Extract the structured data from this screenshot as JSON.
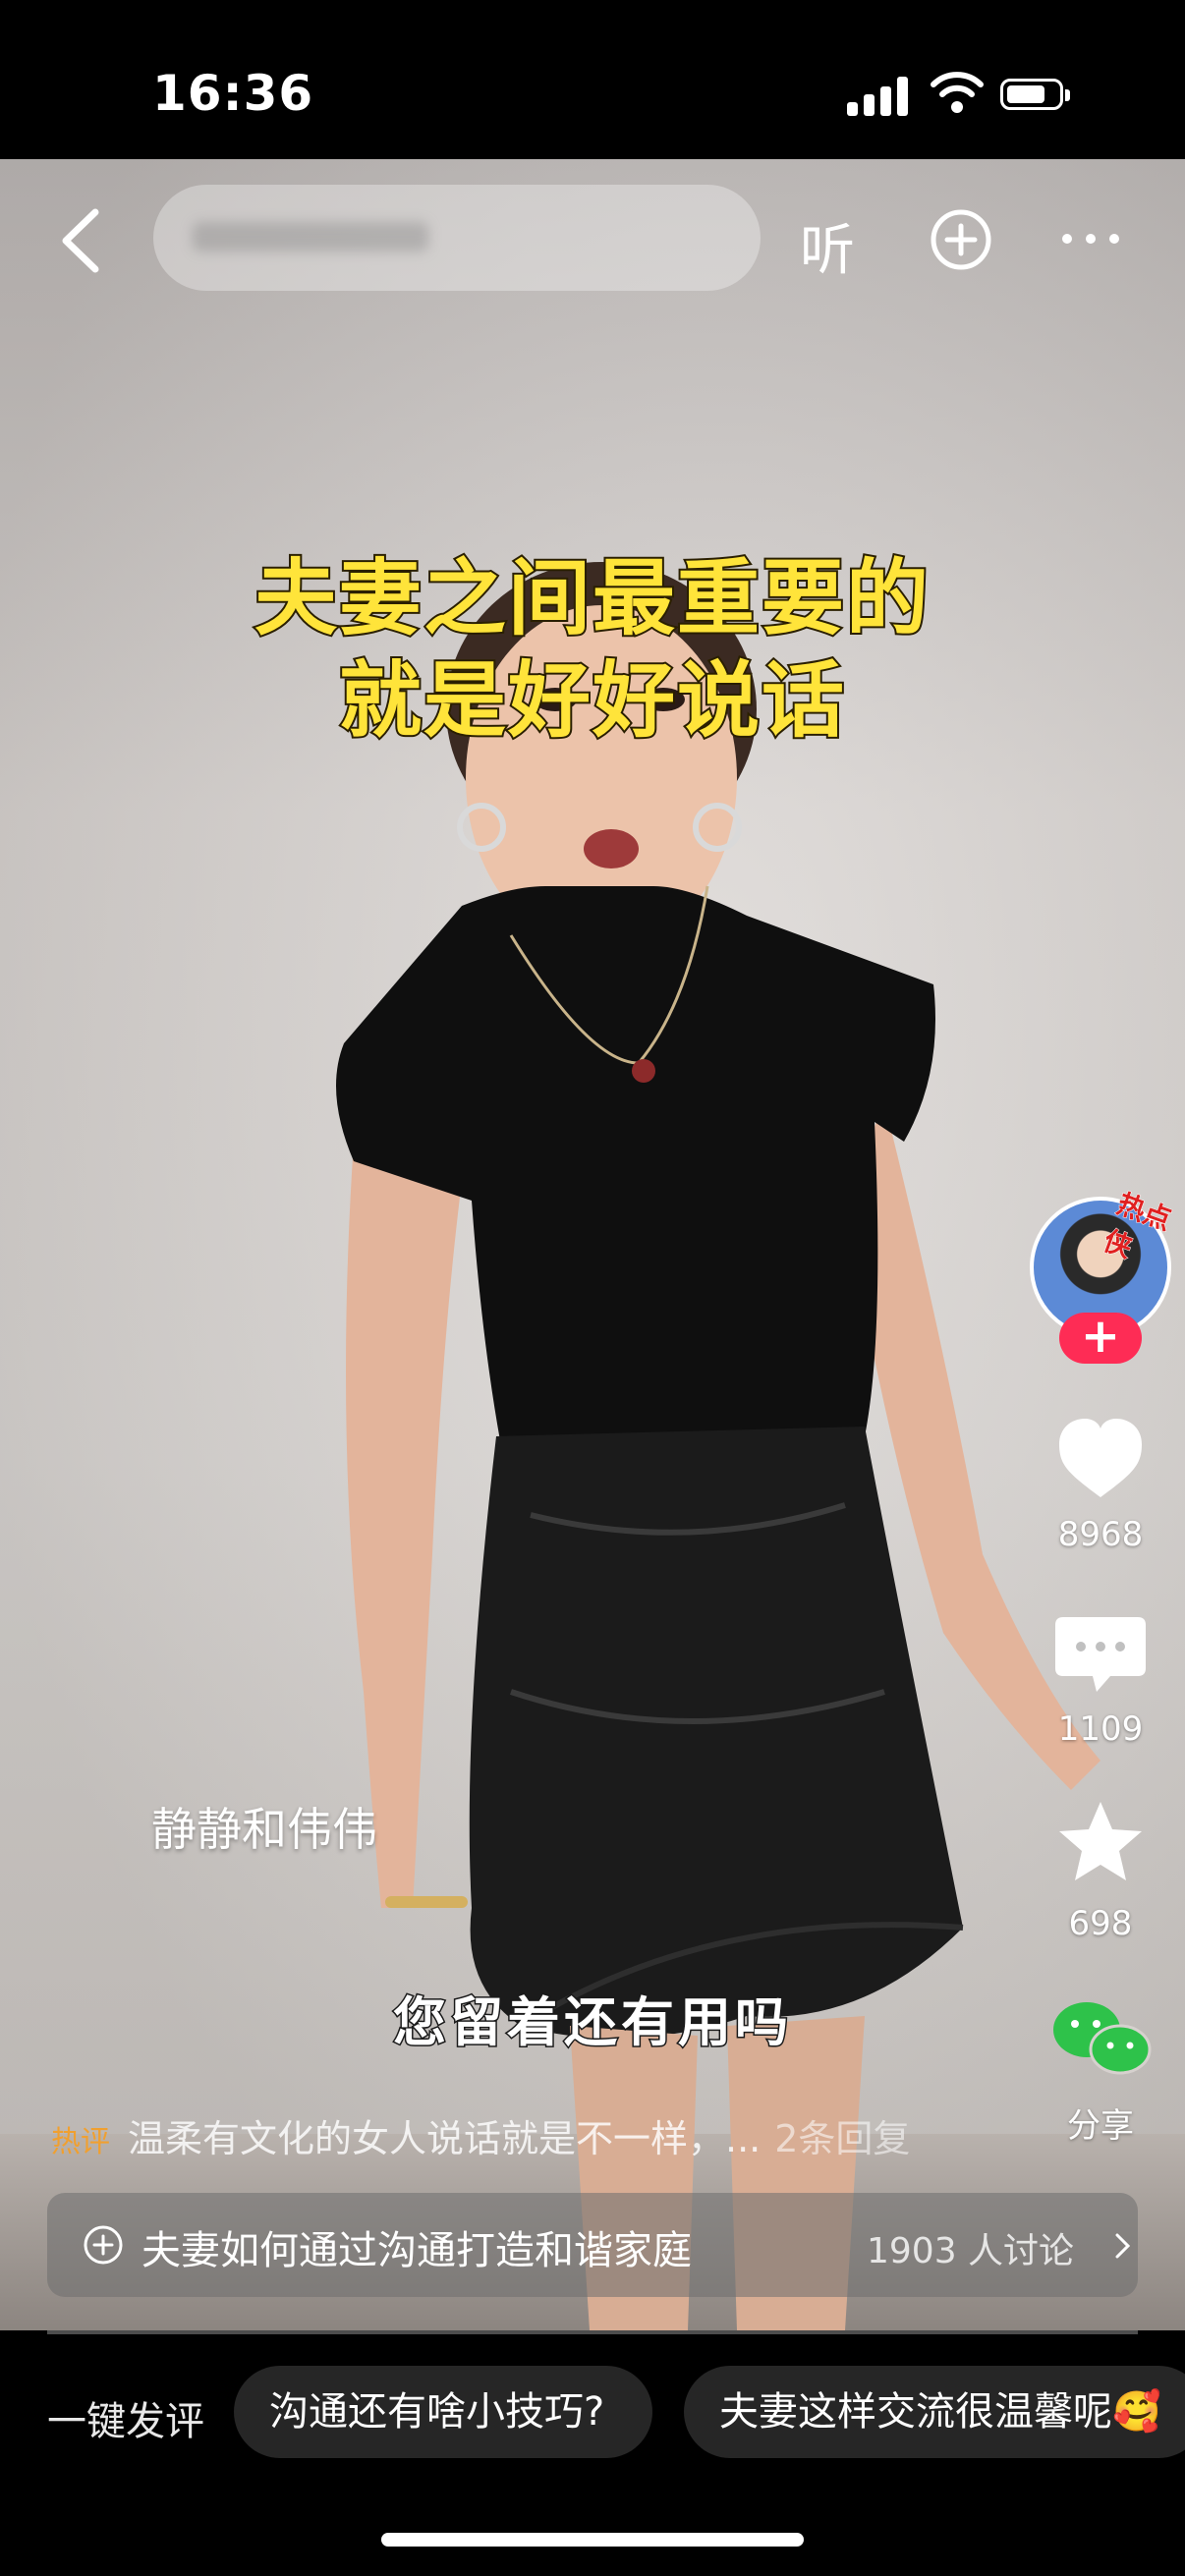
{
  "status_bar": {
    "time": "16:36"
  },
  "top_bar": {
    "search_placeholder": "",
    "listen_label": "听"
  },
  "video": {
    "caption_line1": "夫妻之间最重要的",
    "caption_line2": "就是好好说话",
    "subtitle": "您留着还有用吗",
    "author": "静静和伟伟",
    "progress": 0.0
  },
  "side_actions": {
    "avatar_badge": "热点侠",
    "follow_label": "+",
    "likes": "8968",
    "comments": "1109",
    "favorites": "698",
    "share_label": "分享"
  },
  "hot_comment": {
    "tag": "热评",
    "text": "温柔有文化的女人说话就是不一样，...",
    "replies": "2条回复"
  },
  "topic": {
    "text": "夫妻如何通过沟通打造和谐家庭",
    "count": "1903 人讨论"
  },
  "quick_comment": {
    "label": "一键发评",
    "chips": [
      "沟通还有啥小技巧?",
      "夫妻这样交流很温馨呢🥰"
    ]
  },
  "colors": {
    "caption": "#ffe43a",
    "follow": "#fe2c55",
    "wechat": "#2ec24a"
  }
}
